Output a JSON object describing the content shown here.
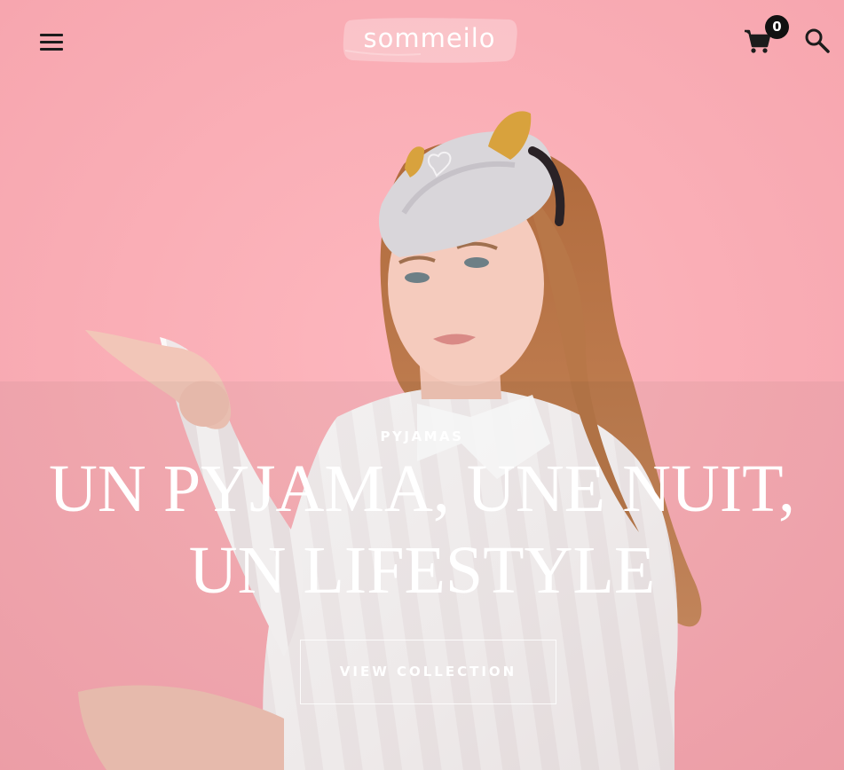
{
  "header": {
    "logo_text": "sommeilo",
    "cart_count": "0"
  },
  "hero": {
    "eyebrow": "PYJAMAS",
    "headline_line1": "UN PYJAMA, UNE NUIT,",
    "headline_line2": "UN LIFESTYLE",
    "cta_label": "VIEW COLLECTION"
  },
  "colors": {
    "background": "#f9aeb5",
    "text_light": "#ffffff",
    "icon_dark": "#1c1c1c",
    "badge": "#111111"
  },
  "icons": [
    "menu-icon",
    "cart-icon",
    "search-icon"
  ]
}
